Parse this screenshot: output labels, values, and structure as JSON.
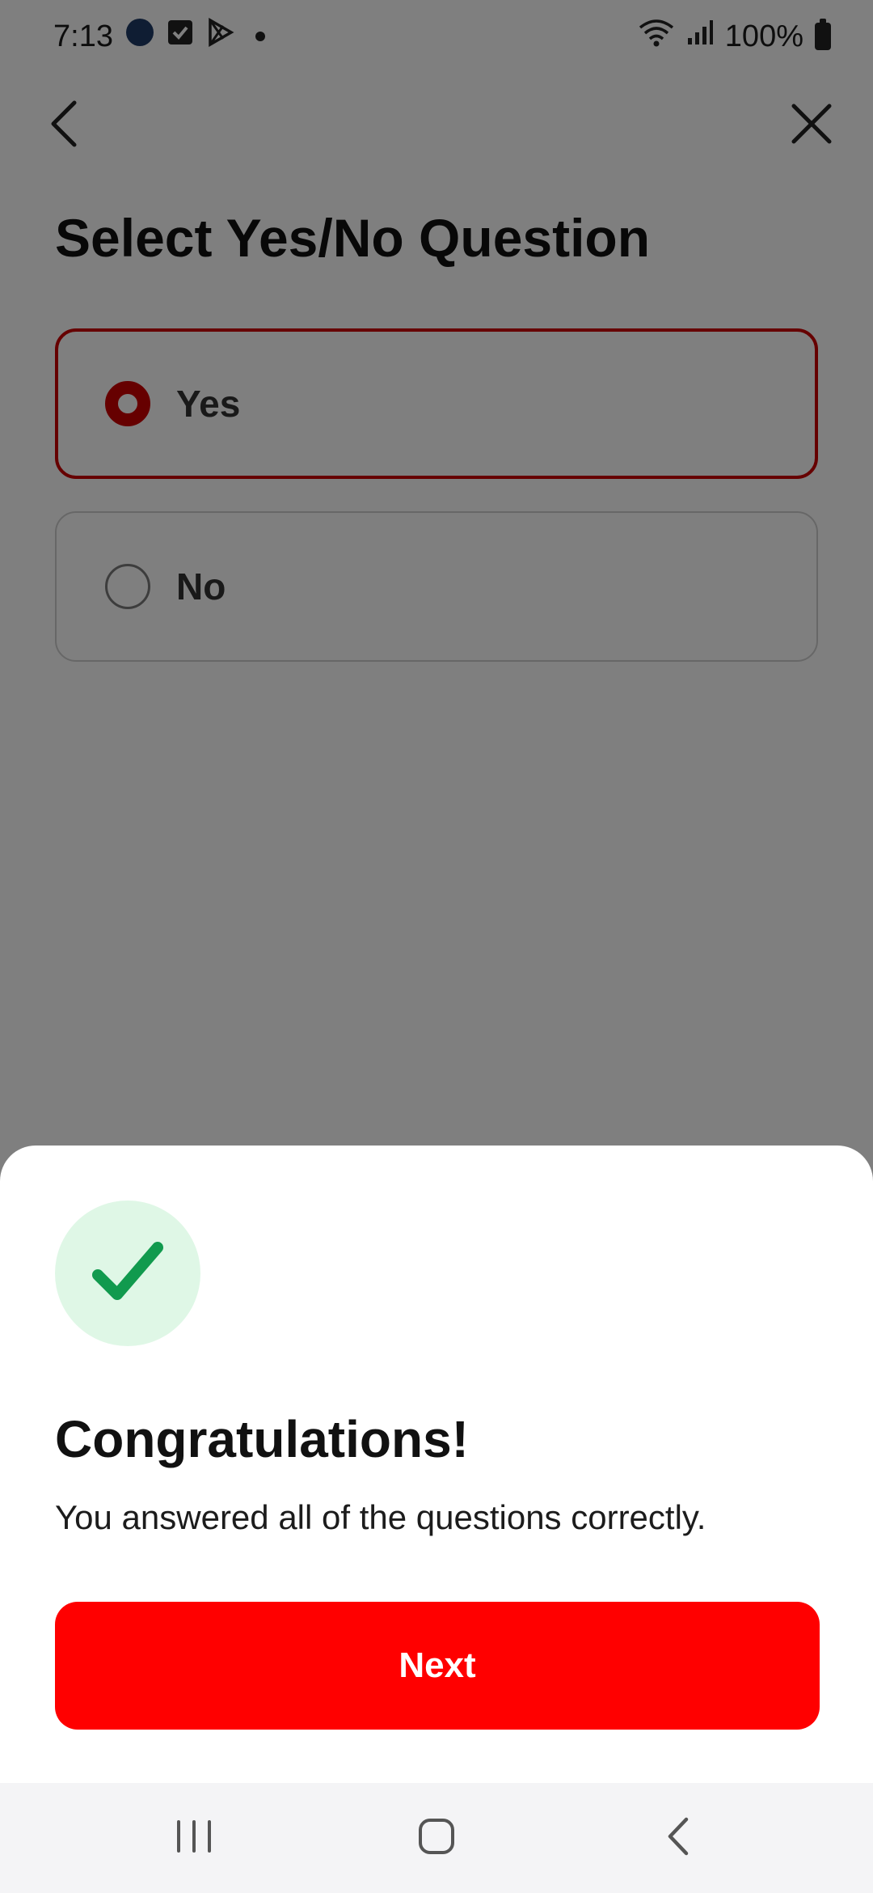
{
  "status_bar": {
    "time": "7:13",
    "battery_text": "100%",
    "icons": [
      "app-icon",
      "checkbox-icon",
      "play-store-icon",
      "wifi-icon",
      "signal-icon",
      "battery-icon"
    ]
  },
  "app_bar": {
    "back_icon": "chevron-left-icon",
    "close_icon": "close-icon"
  },
  "question": {
    "title": "Select Yes/No Question",
    "options": [
      {
        "label": "Yes",
        "selected": true
      },
      {
        "label": "No",
        "selected": false
      }
    ]
  },
  "result_sheet": {
    "icon": "checkmark-icon",
    "title": "Congratulations!",
    "message": "You answered all of the questions correctly.",
    "next_label": "Next"
  },
  "nav_bar": {
    "icons": [
      "recent-apps-icon",
      "home-icon",
      "back-icon"
    ]
  },
  "colors": {
    "accent_red": "#ff0000",
    "selected_border": "#cc0000",
    "success_green": "#119a4e",
    "success_bg": "#dff7e6",
    "scrim": "rgba(0,0,0,0.5)"
  }
}
